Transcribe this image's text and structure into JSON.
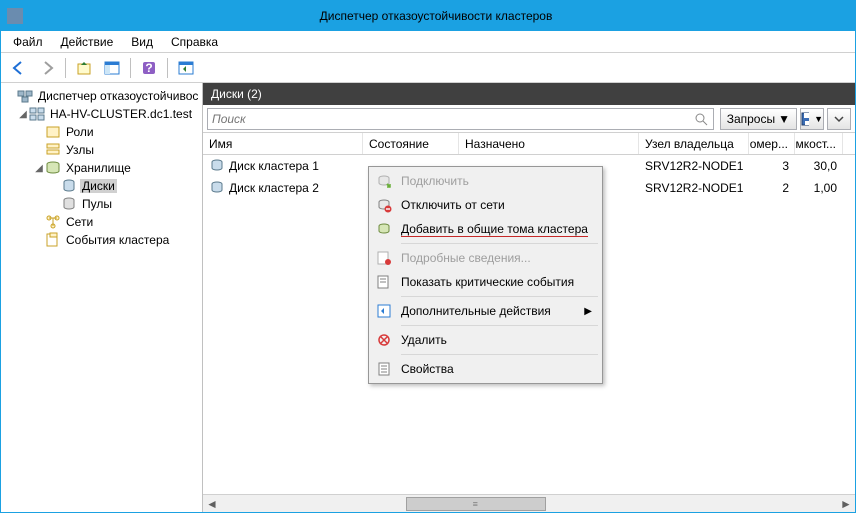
{
  "window": {
    "title": "Диспетчер отказоустойчивости кластеров"
  },
  "menubar": {
    "file": "Файл",
    "action": "Действие",
    "view": "Вид",
    "help": "Справка"
  },
  "tree": {
    "root": "Диспетчер отказоустойчивос",
    "cluster": "HA-HV-CLUSTER.dc1.test",
    "roles": "Роли",
    "nodes": "Узлы",
    "storage": "Хранилище",
    "disks": "Диски",
    "pools": "Пулы",
    "networks": "Сети",
    "events": "События кластера"
  },
  "main": {
    "header": "Диски (2)",
    "search_placeholder": "Поиск",
    "queries_btn": "Запросы",
    "columns": {
      "name": "Имя",
      "state": "Состояние",
      "assigned": "Назначено",
      "owner": "Узел владельца",
      "number": "Номер...",
      "capacity": "Емкост..."
    },
    "rows": [
      {
        "name": "Диск кластера 1",
        "owner": "SRV12R2-NODE1",
        "number": "3",
        "capacity": "30,0"
      },
      {
        "name": "Диск кластера 2",
        "owner": "SRV12R2-NODE1",
        "number": "2",
        "capacity": "1,00"
      }
    ]
  },
  "context_menu": {
    "connect": "Подключить",
    "disconnect": "Отключить от сети",
    "add_csv": "Добавить в общие тома кластера",
    "details": "Подробные сведения...",
    "critical_events": "Показать критические события",
    "more_actions": "Дополнительные действия",
    "delete": "Удалить",
    "properties": "Свойства"
  }
}
